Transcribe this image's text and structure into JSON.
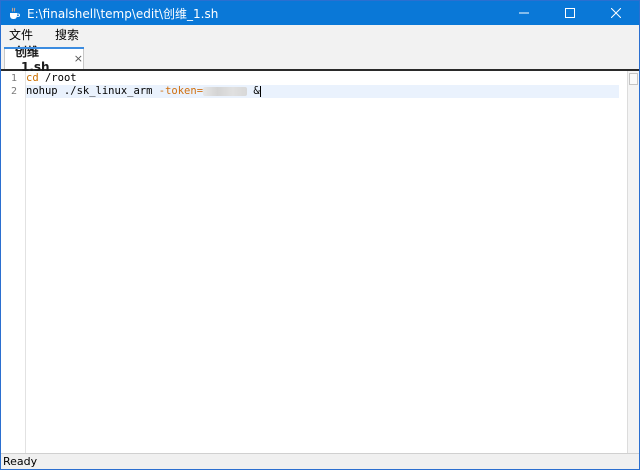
{
  "window": {
    "title": "E:\\finalshell\\temp\\edit\\创维_1.sh",
    "icon": "java-cup-icon",
    "accent_color": "#0a78d7"
  },
  "menu": {
    "items": [
      {
        "label": "文件"
      },
      {
        "label": "搜索"
      }
    ]
  },
  "tabs": [
    {
      "label": "创维_1.sh",
      "close": "×",
      "active": true
    }
  ],
  "editor": {
    "line_numbers": [
      "1",
      "2"
    ],
    "lines": [
      {
        "cmd": "cd",
        "rest": " /root"
      },
      {
        "cmd": "nohup ./sk_linux_arm ",
        "flag": "-token=",
        "tail": " &"
      }
    ],
    "current_line": 2
  },
  "status": {
    "text": "Ready"
  }
}
